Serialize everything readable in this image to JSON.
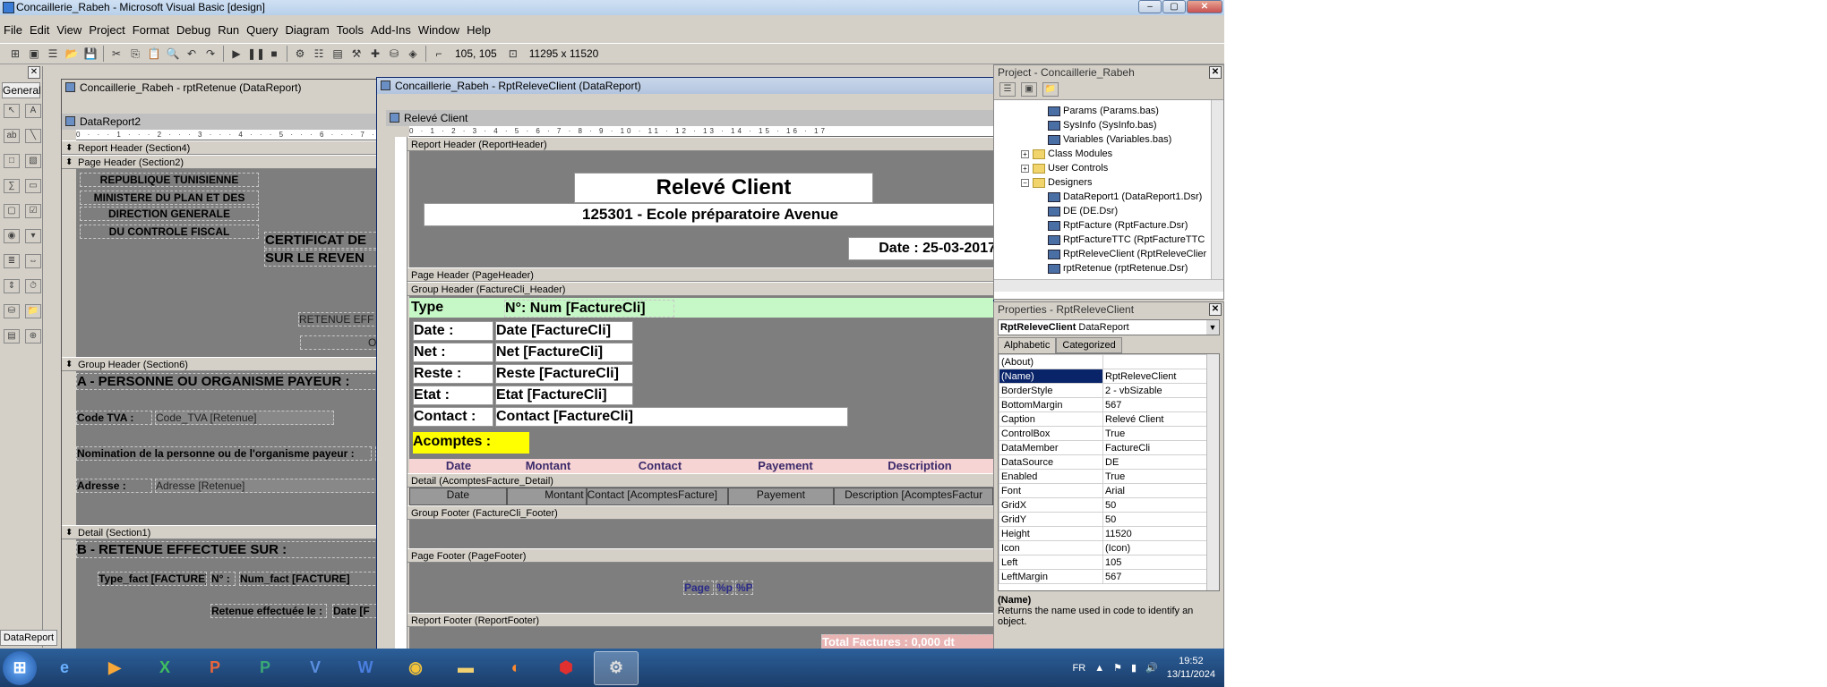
{
  "window": {
    "title": "Concaillerie_Rabeh - Microsoft Visual Basic [design]",
    "controls": {
      "minimize": "–",
      "maximize": "▢",
      "close": "✕"
    }
  },
  "menu": [
    "File",
    "Edit",
    "View",
    "Project",
    "Format",
    "Debug",
    "Run",
    "Query",
    "Diagram",
    "Tools",
    "Add-Ins",
    "Window",
    "Help"
  ],
  "toolbar": {
    "position": "105, 105",
    "size": "11295 x 11520"
  },
  "toolbox": {
    "tab": "General",
    "bottom_tab": "DataReport"
  },
  "retenue_window": {
    "title": "Concaillerie_Rabeh - rptRetenue (DataReport)",
    "inner_title": "DataReport2",
    "sections": {
      "report_header": "Report Header (Section4)",
      "page_header": "Page Header (Section2)",
      "group_header": "Group Header (Section6)",
      "detail": "Detail (Section1)"
    },
    "fields": {
      "republique": "REPUBLIQUE TUNISIENNE",
      "ministere": "MINISTERE DU PLAN ET DES",
      "direction": "DIRECTION GENERALE",
      "controle": "DU CONTROLE FISCAL",
      "certificat": "CERTIFICAT DE",
      "sur_le_revenu": "SUR LE REVEN",
      "retenue_eff": "RETENUE EFF",
      "ou": "OU",
      "personne": "A - PERSONNE OU ORGANISME PAYEUR :",
      "code_tva_label": "Code TVA :",
      "code_tva_value": "Code_TVA [Retenue]",
      "nomination": "Nomination de la personne ou de l'organisme payeur :",
      "nomination_tail": "N",
      "adresse_label": "Adresse :",
      "adresse_value": "Adresse [Retenue]",
      "retenue_sur": "B - RETENUE EFFECTUEE SUR :",
      "type_fact": "Type_fact [FACTURE]",
      "n_label": "N° :",
      "num_fact": "Num_fact [FACTURE]",
      "retenue_le": "Retenue effectuée le :",
      "date_f": "Date [F"
    }
  },
  "releve_window": {
    "title": "Concaillerie_Rabeh - RptReleveClient (DataReport)",
    "inner_title": "Relevé Client",
    "sections": {
      "report_header": "Report Header (ReportHeader)",
      "page_header": "Page Header (PageHeader)",
      "group_header": "Group Header (FactureCli_Header)",
      "detail": "Detail (AcomptesFacture_Detail)",
      "group_footer": "Group Footer (FactureCli_Footer)",
      "page_footer": "Page Footer (PageFooter)",
      "report_footer": "Report Footer (ReportFooter)"
    },
    "header": {
      "title": "Relevé Client",
      "company": "125301 - Ecole préparatoire Avenue",
      "date": "Date : 25-03-2017"
    },
    "group": {
      "type": "Type",
      "num": "N°: Num [FactureCli]",
      "date_label": "Date :",
      "date_value": "Date [FactureCli]",
      "net_label": "Net :",
      "net_value": "Net [FactureCli]",
      "reste_label": "Reste :",
      "reste_value": "Reste [FactureCli]",
      "etat_label": "Etat :",
      "etat_value": "Etat [FactureCli]",
      "contact_label": "Contact :",
      "contact_value": "Contact [FactureCli]",
      "acomptes": "Acomptes :"
    },
    "columns": [
      "Date",
      "Montant",
      "Contact",
      "Payement",
      "Description"
    ],
    "detail_fields": [
      "Date",
      "Montant",
      "Contact [AcomptesFacture]",
      "Payement",
      "Description [AcomptesFactur"
    ],
    "page_footer": {
      "page": "Page",
      "sp": "%p",
      "bp": "%P"
    },
    "report_footer": "Total Factures : 0,000 dt"
  },
  "project": {
    "title": "Project - Concaillerie_Rabeh",
    "items": [
      {
        "label": "Params (Params.bas)",
        "kind": "module",
        "level": 3
      },
      {
        "label": "SysInfo (SysInfo.bas)",
        "kind": "module",
        "level": 3
      },
      {
        "label": "Variables (Variables.bas)",
        "kind": "module",
        "level": 3
      },
      {
        "label": "Class Modules",
        "kind": "folder",
        "level": 2,
        "toggle": "+"
      },
      {
        "label": "User Controls",
        "kind": "folder",
        "level": 2,
        "toggle": "+"
      },
      {
        "label": "Designers",
        "kind": "folder",
        "level": 2,
        "toggle": "−"
      },
      {
        "label": "DataReport1 (DataReport1.Dsr)",
        "kind": "module",
        "level": 3
      },
      {
        "label": "DE (DE.Dsr)",
        "kind": "module",
        "level": 3
      },
      {
        "label": "RptFacture (RptFacture.Dsr)",
        "kind": "module",
        "level": 3
      },
      {
        "label": "RptFactureTTC (RptFactureTTC",
        "kind": "module",
        "level": 3
      },
      {
        "label": "RptReleveClient (RptReleveClier",
        "kind": "module",
        "level": 3
      },
      {
        "label": "rptRetenue (rptRetenue.Dsr)",
        "kind": "module",
        "level": 3
      }
    ]
  },
  "properties": {
    "title": "Properties - RptReleveClient",
    "object": "RptReleveClient",
    "object_type": "DataReport",
    "tabs": [
      "Alphabetic",
      "Categorized"
    ],
    "rows": [
      {
        "k": "(About)",
        "v": ""
      },
      {
        "k": "(Name)",
        "v": "RptReleveClient"
      },
      {
        "k": "BorderStyle",
        "v": "2 - vbSizable"
      },
      {
        "k": "BottomMargin",
        "v": "567"
      },
      {
        "k": "Caption",
        "v": "Relevé Client"
      },
      {
        "k": "ControlBox",
        "v": "True"
      },
      {
        "k": "DataMember",
        "v": "FactureCli"
      },
      {
        "k": "DataSource",
        "v": "DE"
      },
      {
        "k": "Enabled",
        "v": "True"
      },
      {
        "k": "Font",
        "v": "Arial"
      },
      {
        "k": "GridX",
        "v": "50"
      },
      {
        "k": "GridY",
        "v": "50"
      },
      {
        "k": "Height",
        "v": "11520"
      },
      {
        "k": "Icon",
        "v": "(Icon)"
      },
      {
        "k": "Left",
        "v": "105"
      },
      {
        "k": "LeftMargin",
        "v": "567"
      }
    ],
    "desc_title": "(Name)",
    "desc_text": "Returns the name used in code to identify an object."
  },
  "taskbar": {
    "apps": [
      "start",
      "ie",
      "media",
      "excel",
      "powerpoint",
      "publisher",
      "visio",
      "word",
      "chrome",
      "explorer",
      "firefox",
      "pdf",
      "vb6"
    ],
    "lang": "FR",
    "time": "19:52",
    "date": "13/11/2024"
  }
}
